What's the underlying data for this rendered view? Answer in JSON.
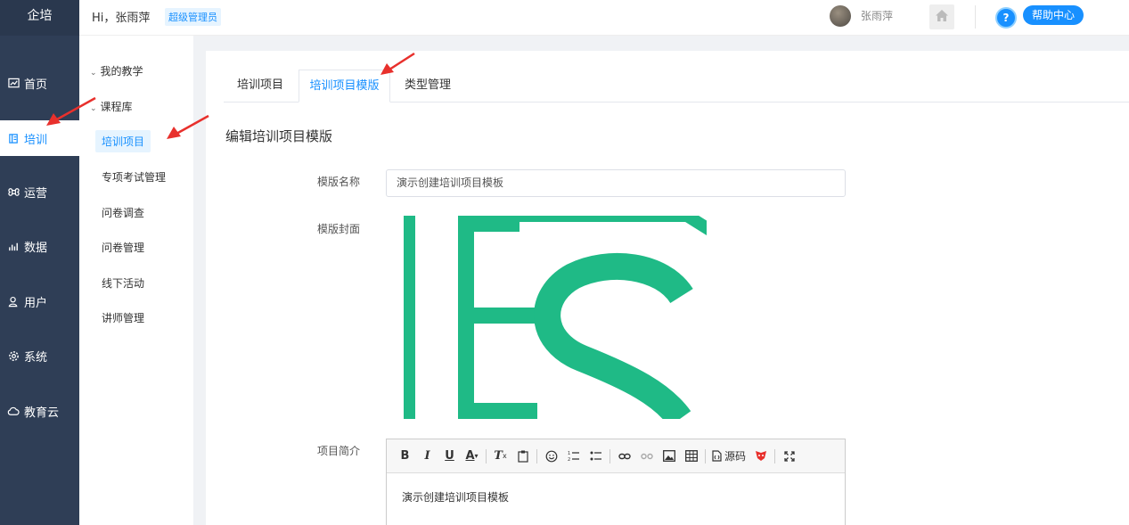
{
  "nav": {
    "logo": "企培",
    "items": [
      {
        "label": "首页",
        "icon": "chart-icon"
      },
      {
        "label": "培训",
        "icon": "book-icon"
      },
      {
        "label": "运营",
        "icon": "command-icon"
      },
      {
        "label": "数据",
        "icon": "bar-chart-icon"
      },
      {
        "label": "用户",
        "icon": "user-icon"
      },
      {
        "label": "系统",
        "icon": "gear-icon"
      },
      {
        "label": "教育云",
        "icon": "cloud-icon"
      }
    ]
  },
  "header": {
    "greeting": "Hi，张雨萍",
    "role_badge": "超级管理员",
    "username": "张雨萍",
    "help_label": "帮助中心",
    "help_icon_glyph": "?"
  },
  "subnav": {
    "groups": [
      {
        "label": "我的教学"
      },
      {
        "label": "课程库"
      }
    ],
    "items": [
      {
        "label": "培训项目"
      },
      {
        "label": "专项考试管理"
      },
      {
        "label": "问卷调查"
      },
      {
        "label": "问卷管理"
      },
      {
        "label": "线下活动"
      },
      {
        "label": "讲师管理"
      }
    ]
  },
  "tabs": [
    {
      "label": "培训项目"
    },
    {
      "label": "培训项目模版"
    },
    {
      "label": "类型管理"
    }
  ],
  "form": {
    "page_title": "编辑培训项目模版",
    "name_label": "模版名称",
    "name_value": "演示创建培训项目模板",
    "cover_label": "模版封面",
    "intro_label": "项目简介",
    "intro_text": "演示创建培训项目模板"
  },
  "editor": {
    "source_label": "源码"
  },
  "colors": {
    "nav_bg": "#2f3e56",
    "accent": "#1890ff",
    "cover_green": "#1fba86",
    "arrow_red": "#e8302c"
  }
}
